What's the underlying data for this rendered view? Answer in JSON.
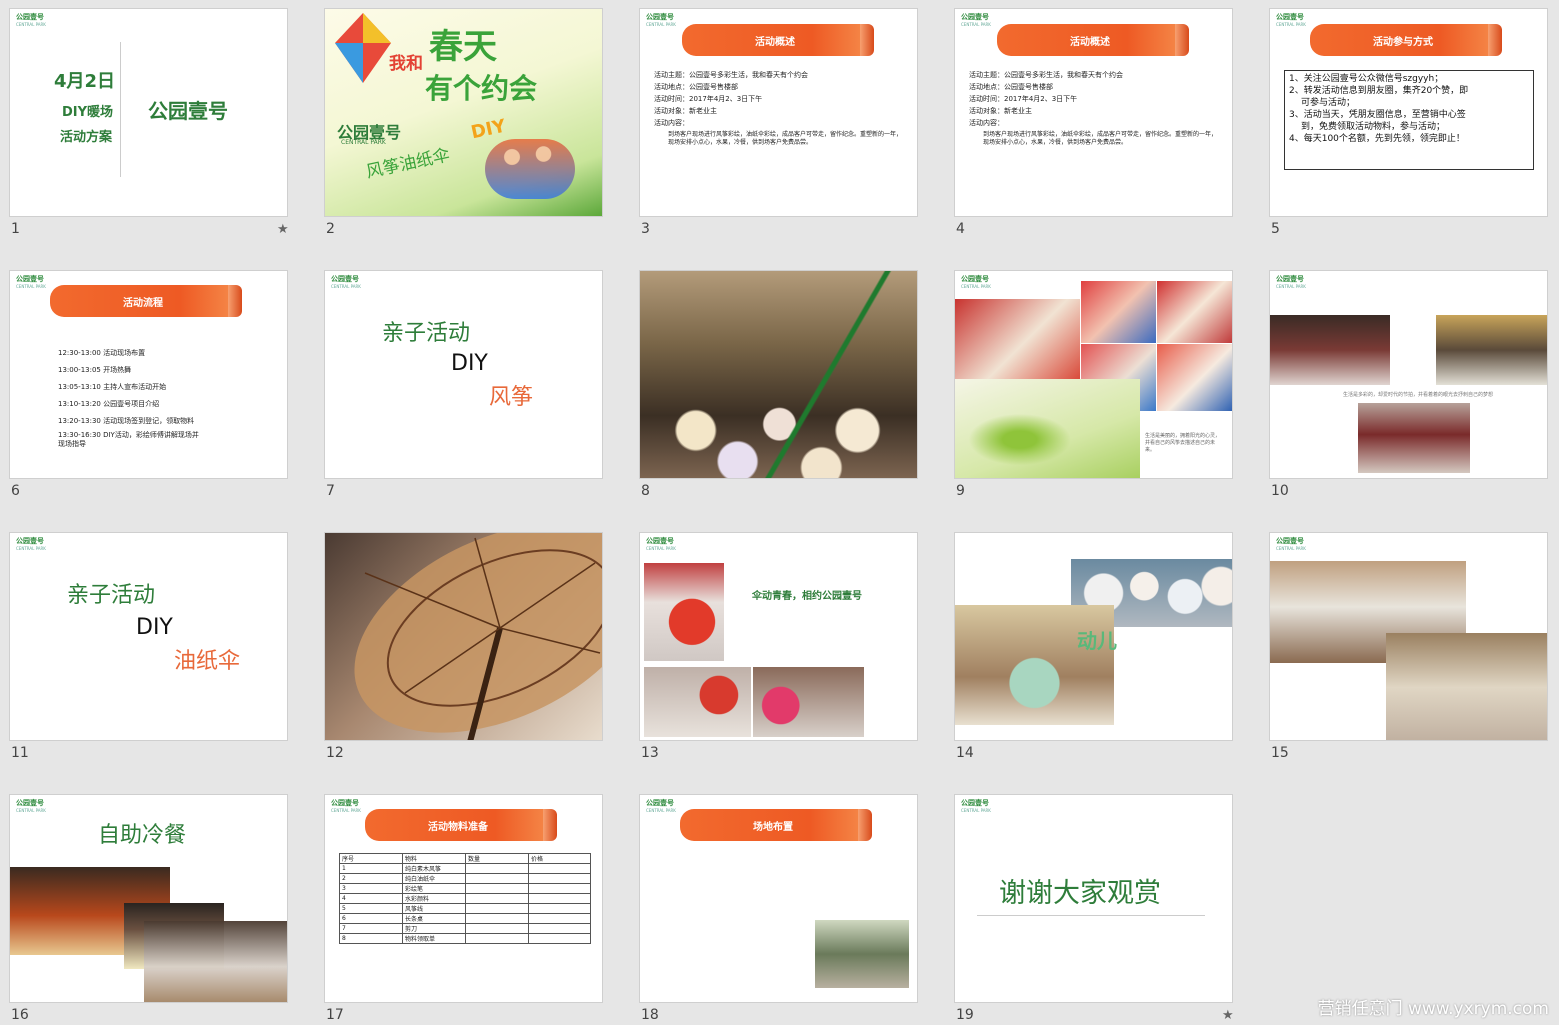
{
  "colors": {
    "green": "#2e7d3a",
    "orange": "#e8693a",
    "banner": "#ee5a24",
    "bg": "#e6e6e6"
  },
  "logo": {
    "name": "公园壹号",
    "sub": "CENTRAL PARK"
  },
  "slides": [
    {
      "num": "1",
      "starred": true,
      "date": "4月2日",
      "line2": "DIY暖场",
      "line3": "活动方案",
      "brand": "公园壹号"
    },
    {
      "num": "2",
      "t1": "我和",
      "t2": "春天",
      "t3": "有个约会",
      "t4": "风筝油纸伞",
      "t5": "DIY",
      "brand": "公园壹号",
      "brand_sub": "CENTRAL PARK"
    },
    {
      "num": "3",
      "banner": "活动概述",
      "bullets": [
        "活动主题：公园壹号多彩生活，我和春天有个约会",
        "活动地点：公园壹号售楼部",
        "活动时间：2017年4月2、3日下午",
        "活动对象：新老业主",
        "活动内容："
      ],
      "para": "到场客户现场进行风筝彩绘，油纸伞彩绘，成品客户可带走，留作纪念。重塑新的一年，现场安排小点心，水果，冷餐，供到场客户免费品尝。"
    },
    {
      "num": "4",
      "banner": "活动概述",
      "bullets": [
        "活动主题：公园壹号多彩生活，我和春天有个约会",
        "活动地点：公园壹号售楼部",
        "活动时间：2017年4月2、3日下午",
        "活动对象：新老业主",
        "活动内容："
      ],
      "para": "到场客户现场进行风筝彩绘，油纸伞彩绘，成品客户可带走，留作纪念。重塑新的一年，现场安排小点心，水果，冷餐，供到场客户免费品尝。"
    },
    {
      "num": "5",
      "banner": "活动参与方式",
      "items": [
        "1、关注公园壹号公众微信号szgyyh；",
        "2、转发活动信息到朋友圈，集齐20个赞，即",
        "可参与活动；",
        "3、活动当天，凭朋友圈信息，至营销中心签",
        "到，免费领取活动物料，参与活动；",
        "4、每天100个名额，先到先领，领完即止！"
      ]
    },
    {
      "num": "6",
      "banner": "活动流程",
      "items": [
        "12:30-13:00  活动现场布置",
        "13:00-13:05  开场热舞",
        "13:05-13:10 主持人宣布活动开始",
        "13:10-13:20  公园壹号项目介绍",
        "13:20-13:30 活动现场签到登记，领取物料",
        "13:30-16:30 DIY活动，彩绘师傅讲解现场并",
        "现场指导"
      ]
    },
    {
      "num": "7",
      "a": "亲子活动",
      "b": "DIY",
      "c": "风筝"
    },
    {
      "num": "8"
    },
    {
      "num": "9",
      "caption": "生活是美丽的，拥着阳光的心灵，并看自己的风筝去描述自己的未来。"
    },
    {
      "num": "10",
      "caption": "生活是多彩的，却爱时代的节拍，并看着着的眼光去抒刺自己的梦想"
    },
    {
      "num": "11",
      "a": "亲子活动",
      "b": "DIY",
      "c": "油纸伞"
    },
    {
      "num": "12"
    },
    {
      "num": "13",
      "caption": "伞动青春，相约公园壹号"
    },
    {
      "num": "14",
      "sign": "动儿"
    },
    {
      "num": "15"
    },
    {
      "num": "16",
      "title": "自助冷餐"
    },
    {
      "num": "17",
      "banner": "活动物料准备",
      "headers": [
        "序号",
        "物料",
        "数量",
        "价格"
      ],
      "rows": [
        [
          "1",
          "纯白素木风筝"
        ],
        [
          "2",
          "纯白油纸伞"
        ],
        [
          "3",
          "彩绘笔"
        ],
        [
          "4",
          "水彩颜料"
        ],
        [
          "5",
          "风筝线"
        ],
        [
          "6",
          "长条桌"
        ],
        [
          "7",
          "剪刀"
        ],
        [
          "8",
          "物料领取单"
        ]
      ]
    },
    {
      "num": "18",
      "banner": "场地布置"
    },
    {
      "num": "19",
      "starred": true,
      "title": "谢谢大家观赏"
    }
  ],
  "watermark": "营销任意门 www.yxrym.com"
}
